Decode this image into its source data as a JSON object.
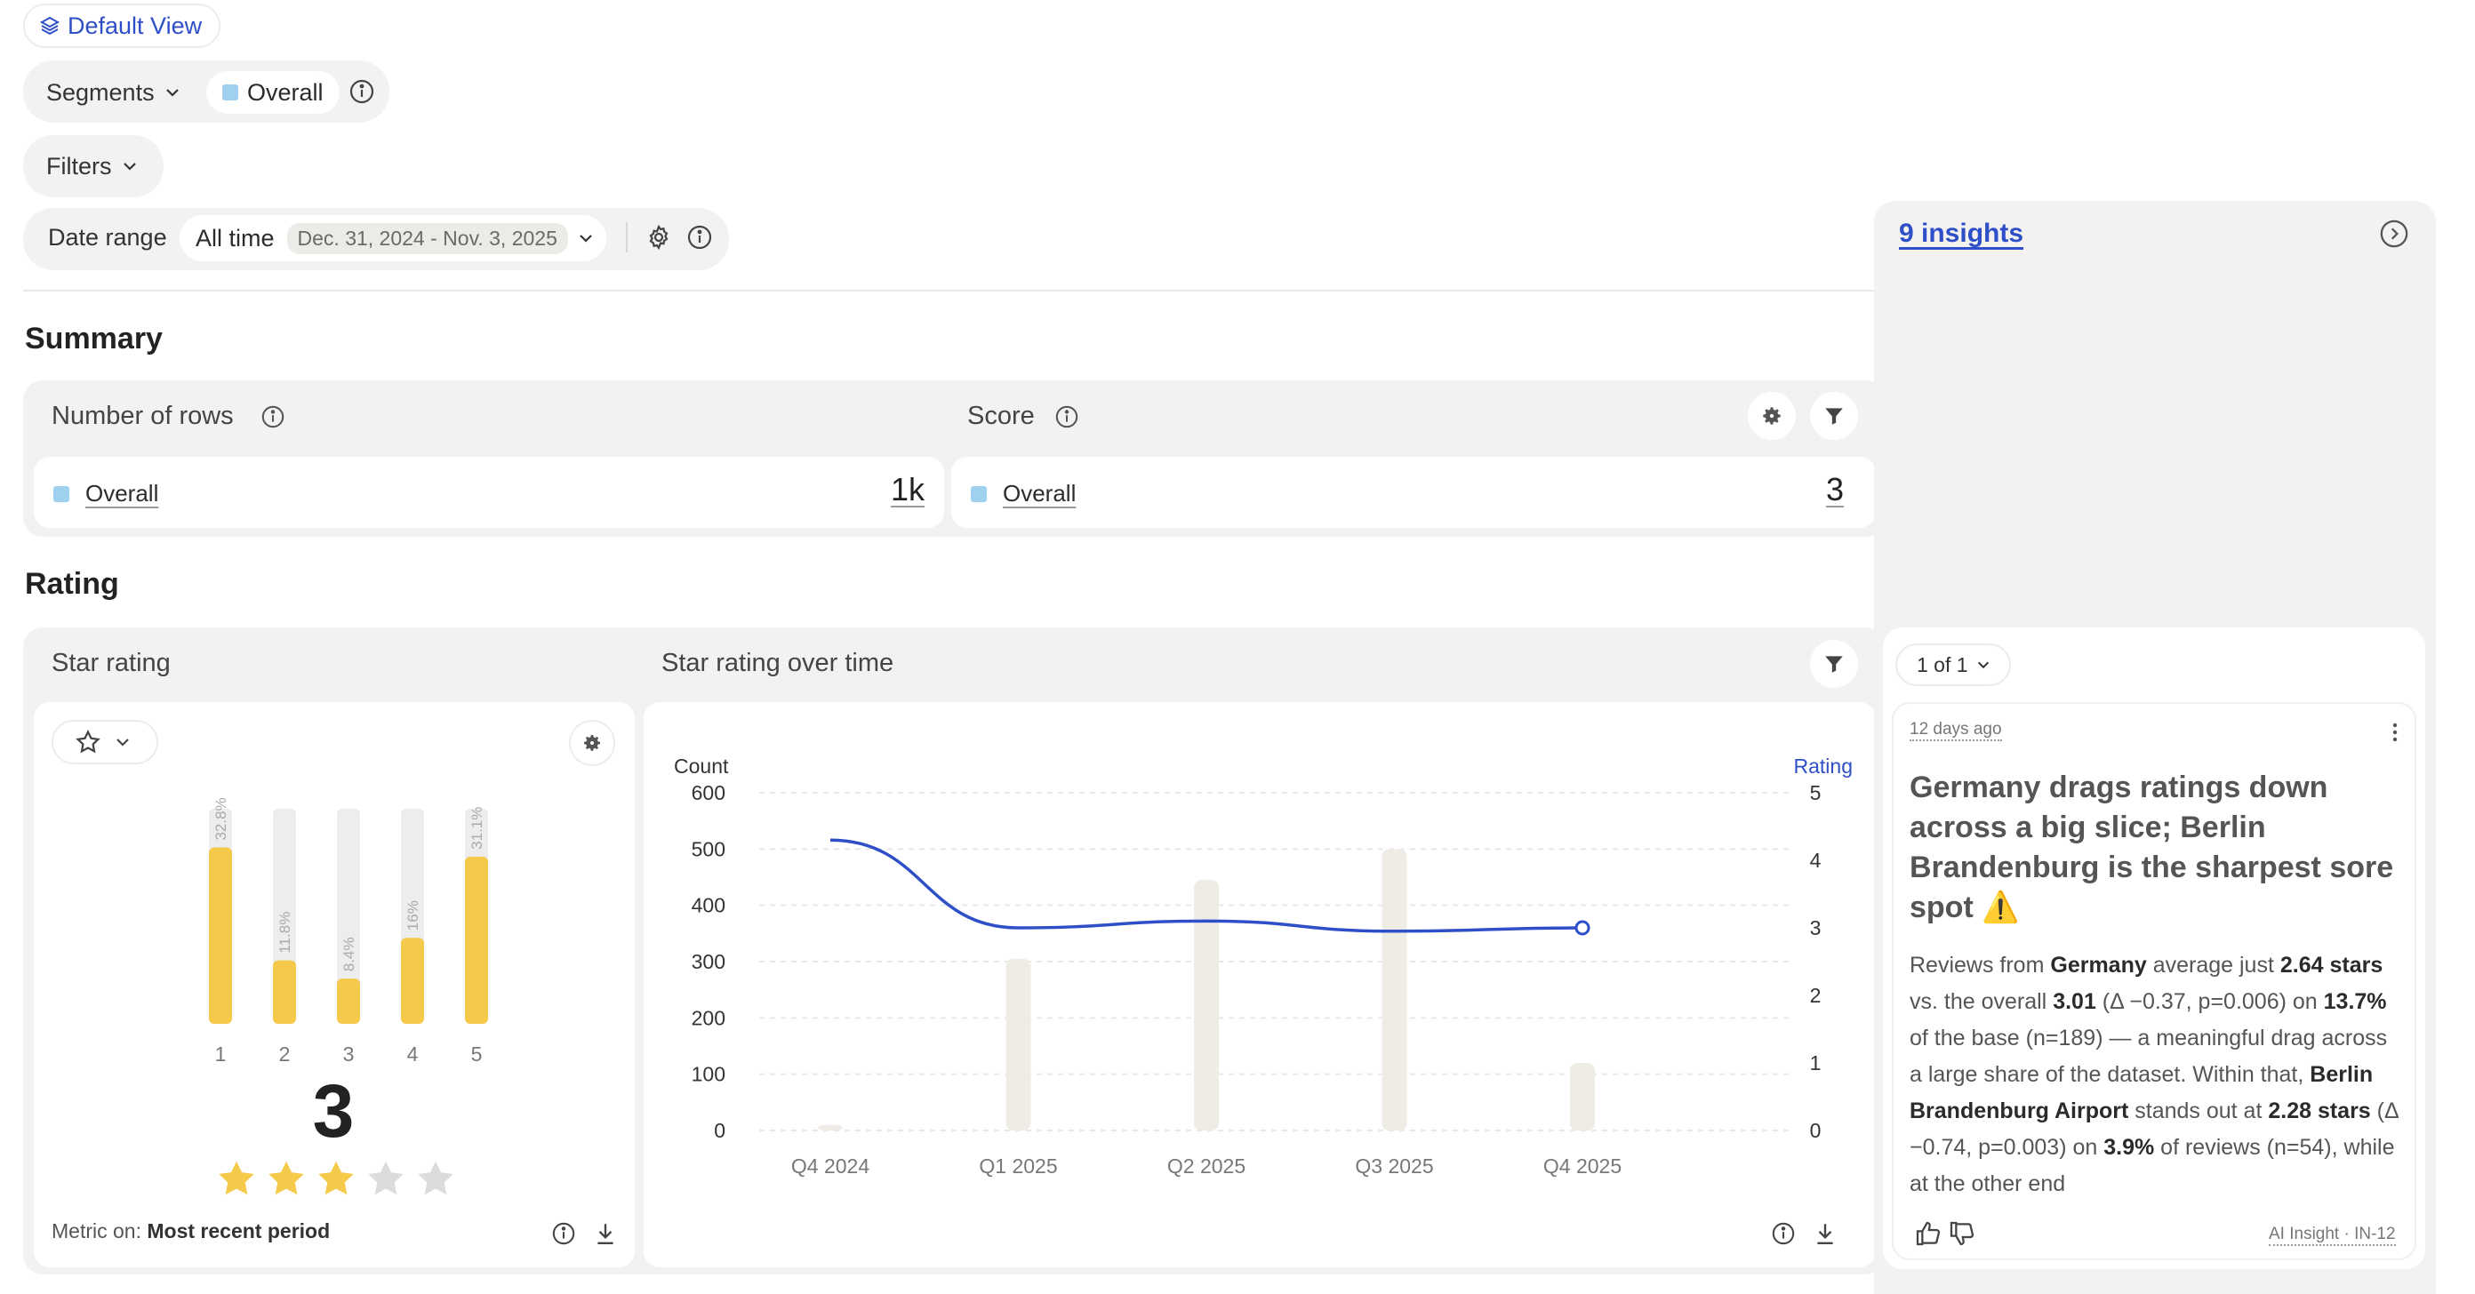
{
  "top": {
    "default_view_label": "Default View",
    "segments_label": "Segments",
    "segment_overall": "Overall",
    "filters_label": "Filters",
    "date_range_label": "Date range",
    "date_range_value": "All time",
    "date_range_dates": "Dec. 31, 2024 - Nov. 3, 2025"
  },
  "summary": {
    "heading": "Summary",
    "rows_title": "Number of rows",
    "rows_segment": "Overall",
    "rows_value": "1k",
    "score_title": "Score",
    "score_segment": "Overall",
    "score_value": "3"
  },
  "rating": {
    "heading": "Rating",
    "star_rating_title": "Star rating",
    "over_time_title": "Star rating over time",
    "big_value": "3",
    "stars_filled": 3,
    "stars_total": 5,
    "metric_on_label": "Metric on:",
    "metric_on_value": "Most recent period"
  },
  "colors": {
    "bar_yellow": "#f5c94a",
    "bar_bg": "#ededed",
    "line_blue": "#2e4fc7",
    "count_bar": "#efece6",
    "star_gray": "#dcdcdc"
  },
  "chart_data": [
    {
      "type": "bar",
      "categories": [
        "1",
        "2",
        "3",
        "4",
        "5"
      ],
      "values": [
        32.8,
        11.8,
        8.4,
        16,
        31.1
      ],
      "value_labels": [
        "32.8%",
        "11.8%",
        "8.4%",
        "16%",
        "31.1%"
      ],
      "ylim": [
        0,
        40
      ]
    },
    {
      "type": "bar",
      "categories": [
        "Q4 2024",
        "Q1 2025",
        "Q2 2025",
        "Q3 2025",
        "Q4 2025"
      ],
      "ylabel": "Count",
      "y2label": "Rating",
      "ylim": [
        0,
        600
      ],
      "y2lim": [
        0,
        5
      ],
      "yticks": [
        "600",
        "500",
        "400",
        "300",
        "200",
        "100",
        "0"
      ],
      "y2ticks": [
        "5",
        "4",
        "3",
        "2",
        "1",
        "0"
      ],
      "series": [
        {
          "type": "bar",
          "axis": "left",
          "values": [
            10,
            305,
            445,
            500,
            120
          ]
        },
        {
          "type": "line",
          "axis": "right",
          "values": [
            4.3,
            3.0,
            3.1,
            2.95,
            3.0
          ]
        }
      ],
      "grid": true
    }
  ],
  "insights": {
    "count_label": "9 insights",
    "pager_label": "1 of 1",
    "time_ago": "12 days ago",
    "title": "Germany drags ratings down across a big slice; Berlin Brandenburg is the sharpest sore spot ⚠️",
    "body_html_parts": [
      {
        "t": "Reviews from "
      },
      {
        "t": "Germany",
        "b": true
      },
      {
        "t": " average just "
      },
      {
        "t": "2.64 stars",
        "b": true
      },
      {
        "t": " vs. the overall "
      },
      {
        "t": "3.01",
        "b": true
      },
      {
        "t": " (Δ −0.37, p=0.006) on "
      },
      {
        "t": "13.7%",
        "b": true
      },
      {
        "t": " of the base (n=189) — a meaningful drag across a large share of the dataset. Within that, "
      },
      {
        "t": "Berlin Brandenburg Airport",
        "b": true
      },
      {
        "t": " stands out at "
      },
      {
        "t": "2.28 stars",
        "b": true
      },
      {
        "t": " (Δ −0.74, p=0.003) on "
      },
      {
        "t": "3.9%",
        "b": true
      },
      {
        "t": " of reviews (n=54), while at the other end"
      }
    ],
    "footer_tag": "AI Insight · IN-12"
  }
}
